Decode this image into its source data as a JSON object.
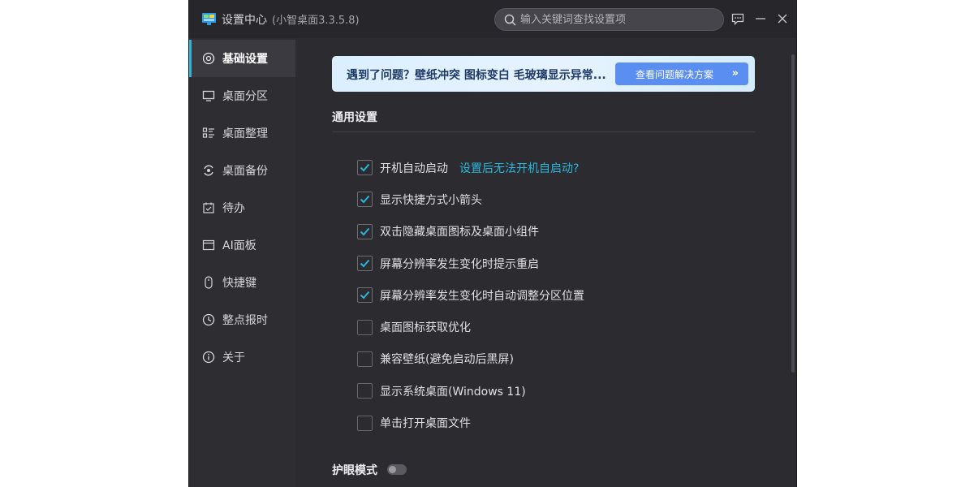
{
  "window": {
    "title": "设置中心",
    "version": "(小智桌面3.3.5.8)"
  },
  "search": {
    "placeholder": "输入关键词查找设置项",
    "value": ""
  },
  "sidebar": {
    "items": [
      {
        "label": "基础设置",
        "icon": "settings-circle-icon",
        "active": true
      },
      {
        "label": "桌面分区",
        "icon": "monitor-icon",
        "active": false
      },
      {
        "label": "桌面整理",
        "icon": "organize-list-icon",
        "active": false
      },
      {
        "label": "桌面备份",
        "icon": "backup-icon",
        "active": false
      },
      {
        "label": "待办",
        "icon": "calendar-check-icon",
        "active": false
      },
      {
        "label": "AI面板",
        "icon": "panel-icon",
        "active": false
      },
      {
        "label": "快捷键",
        "icon": "mouse-icon",
        "active": false
      },
      {
        "label": "整点报时",
        "icon": "clock-icon",
        "active": false
      },
      {
        "label": "关于",
        "icon": "info-icon",
        "active": false
      }
    ]
  },
  "banner": {
    "text": "遇到了问题？壁纸冲突 图标变白 毛玻璃显示异常...",
    "button_label": "查看问题解决方案",
    "button_arrow": "»"
  },
  "general": {
    "title": "通用设置",
    "options": [
      {
        "label": "开机自动启动",
        "checked": true,
        "link": "设置后无法开机自启动?"
      },
      {
        "label": "显示快捷方式小箭头",
        "checked": true
      },
      {
        "label": "双击隐藏桌面图标及桌面小组件",
        "checked": true
      },
      {
        "label": "屏幕分辨率发生变化时提示重启",
        "checked": true
      },
      {
        "label": "屏幕分辨率发生变化时自动调整分区位置",
        "checked": true
      },
      {
        "label": "桌面图标获取优化",
        "checked": false
      },
      {
        "label": "兼容壁纸(避免启动后黑屏)",
        "checked": false
      },
      {
        "label": "显示系统桌面(Windows 11)",
        "checked": false
      },
      {
        "label": "单击打开桌面文件",
        "checked": false
      }
    ]
  },
  "eye_mode": {
    "title": "护眼模式",
    "enabled": false
  },
  "colors": {
    "accent": "#2bb5d8",
    "banner_button": "#5a8ef0",
    "background": "#2b2b30"
  }
}
